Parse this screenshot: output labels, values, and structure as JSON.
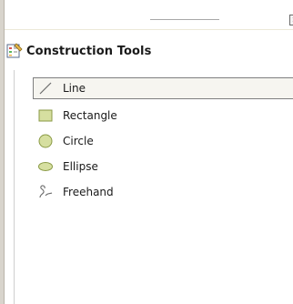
{
  "panel": {
    "title": "Construction Tools",
    "close_icon": "close-icon",
    "header_icon": "construction-tools-icon"
  },
  "tools": [
    {
      "label": "Line",
      "icon": "line-icon",
      "selected": true
    },
    {
      "label": "Rectangle",
      "icon": "rectangle-icon",
      "selected": false
    },
    {
      "label": "Circle",
      "icon": "circle-icon",
      "selected": false
    },
    {
      "label": "Ellipse",
      "icon": "ellipse-icon",
      "selected": false
    },
    {
      "label": "Freehand",
      "icon": "freehand-icon",
      "selected": false
    }
  ],
  "colors": {
    "shape_fill": "#d6dfa0",
    "shape_stroke": "#8a9a45",
    "selection_border": "#7f7f7f"
  }
}
